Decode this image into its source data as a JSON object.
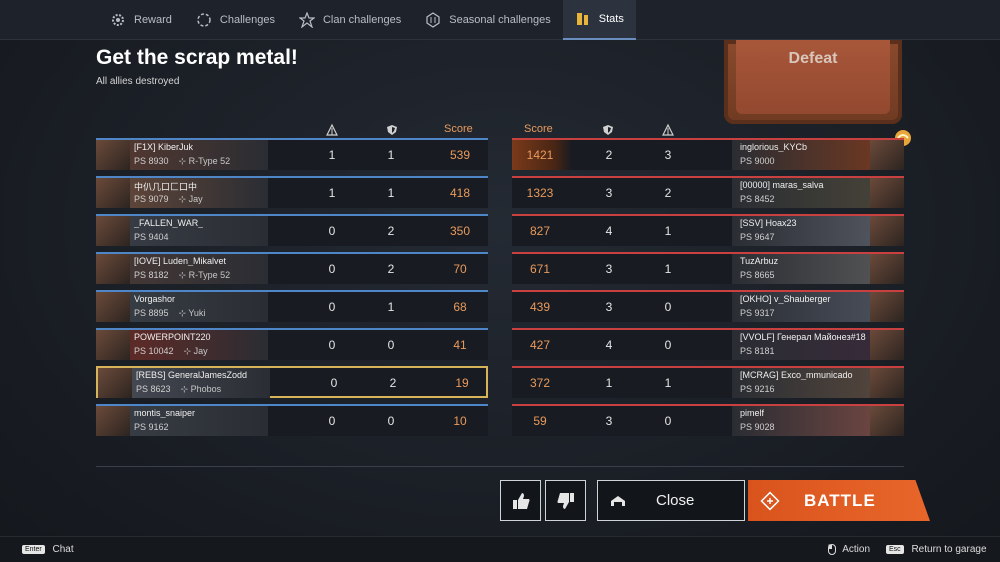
{
  "tabs": [
    {
      "label": "Reward",
      "icon": "gear-reward-icon"
    },
    {
      "label": "Challenges",
      "icon": "challenges-icon"
    },
    {
      "label": "Clan challenges",
      "icon": "clan-icon"
    },
    {
      "label": "Seasonal challenges",
      "icon": "seasonal-icon"
    },
    {
      "label": "Stats",
      "icon": "stats-icon",
      "active": true
    }
  ],
  "title": "Get the scrap metal!",
  "subtitle": "All allies destroyed",
  "result": "Defeat",
  "headers": {
    "score": "Score"
  },
  "colors": {
    "ally": "#4e86c8",
    "enemy": "#c84040",
    "score": "#e99a5c",
    "battle": "#e35f23",
    "highlight": "#d7b35a"
  },
  "allies": [
    {
      "name": "[F1X] KiberJuk",
      "ps": "PS 8930",
      "platoon": "R-Type 52",
      "kills": "1",
      "assists": "1",
      "score": "539"
    },
    {
      "name": "中仈几口匚口中",
      "ps": "PS 9079",
      "platoon": "Jay",
      "kills": "1",
      "assists": "1",
      "score": "418"
    },
    {
      "name": "_FALLEN_WAR_",
      "ps": "PS 9404",
      "platoon": "",
      "kills": "0",
      "assists": "2",
      "score": "350"
    },
    {
      "name": "[IOVE] Luden_Mikalvet",
      "ps": "PS 8182",
      "platoon": "R-Type 52",
      "kills": "0",
      "assists": "2",
      "score": "70"
    },
    {
      "name": "Vorgashor",
      "ps": "PS 8895",
      "platoon": "Yuki",
      "kills": "0",
      "assists": "1",
      "score": "68"
    },
    {
      "name": "POWERPOINT220",
      "ps": "PS 10042",
      "platoon": "Jay",
      "kills": "0",
      "assists": "0",
      "score": "41"
    },
    {
      "name": "[REBS] GeneralJamesZodd",
      "ps": "PS 8623",
      "platoon": "Phobos",
      "kills": "0",
      "assists": "2",
      "score": "19",
      "me": true
    },
    {
      "name": "montis_snaiper",
      "ps": "PS 9162",
      "platoon": "",
      "kills": "0",
      "assists": "0",
      "score": "10"
    }
  ],
  "enemies": [
    {
      "name": "inglorious_KYCb",
      "ps": "PS 9000",
      "score": "1421",
      "assists": "2",
      "kills": "3"
    },
    {
      "name": "[00000] maras_salva",
      "ps": "PS 8452",
      "score": "1323",
      "assists": "3",
      "kills": "2"
    },
    {
      "name": "[SSV] Hoax23",
      "ps": "PS 9647",
      "score": "827",
      "assists": "4",
      "kills": "1"
    },
    {
      "name": "TuzArbuz",
      "ps": "PS 8665",
      "score": "671",
      "assists": "3",
      "kills": "1"
    },
    {
      "name": "[OKHO] v_Shauberger",
      "ps": "PS 9317",
      "score": "439",
      "assists": "3",
      "kills": "0"
    },
    {
      "name": "[VVOLF] Генерал Майонез#18",
      "ps": "PS 8181",
      "score": "427",
      "assists": "4",
      "kills": "0"
    },
    {
      "name": "[MCRAG] Exco_mmunicado",
      "ps": "PS 9216",
      "score": "372",
      "assists": "1",
      "kills": "1"
    },
    {
      "name": "pimelf",
      "ps": "PS 9028",
      "score": "59",
      "assists": "3",
      "kills": "0"
    }
  ],
  "buttons": {
    "close": "Close",
    "battle": "BATTLE"
  },
  "footer": {
    "chat_key": "Enter",
    "chat": "Chat",
    "action": "Action",
    "return_key": "Esc",
    "return": "Return to garage"
  }
}
